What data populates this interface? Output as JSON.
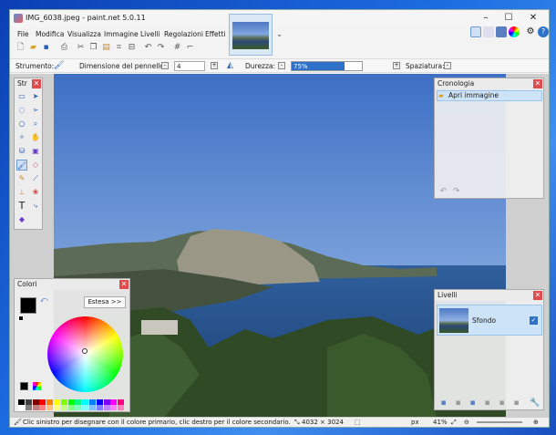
{
  "window": {
    "title": "IMG_6038.jpeg - paint.net 5.0.11"
  },
  "menu": [
    "File",
    "Modifica",
    "Visualizza",
    "Immagine",
    "Livelli",
    "Regolazioni",
    "Effetti"
  ],
  "options": {
    "tool_label": "Strumento:",
    "brush_size_label": "Dimensione del pennello:",
    "brush_size_value": "4",
    "hardness_label": "Durezza:",
    "hardness_value": "75%",
    "hardness_level": 0.75,
    "spacing_label": "Spaziatura:"
  },
  "tools_panel": {
    "title": "Str"
  },
  "history_panel": {
    "title": "Cronologia",
    "items": [
      "Apri immagine"
    ]
  },
  "layers_panel": {
    "title": "Livelli",
    "items": [
      "Sfondo"
    ]
  },
  "colors_panel": {
    "title": "Colori",
    "expand_button": "Estesa >>"
  },
  "status": {
    "hint": "Clic sinistro per disegnare con il colore primario, clic destro per il colore secondario.",
    "image_size": "4032 × 3024",
    "unit": "px",
    "zoom": "41%"
  }
}
